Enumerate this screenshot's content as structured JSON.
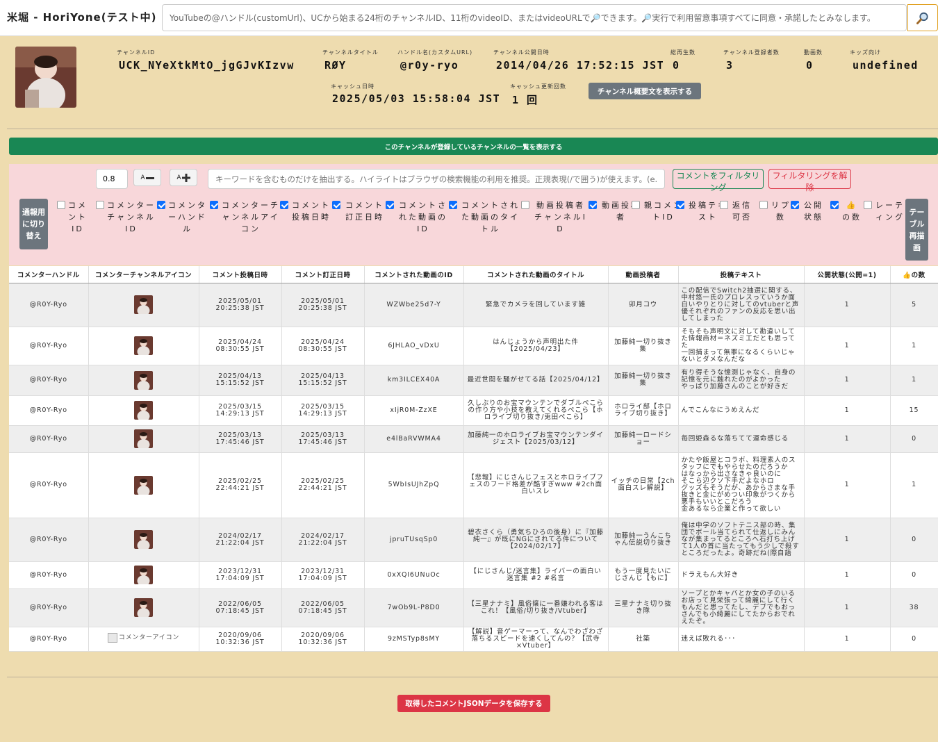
{
  "header": {
    "brand": "米堀 - HoriYone(テスト中)",
    "search_placeholder": "YouTubeの@ハンドル(customUrl)、UCから始まる24桁のチャンネルID、11桁のvideoID、またはvideoURLで🔎できます。🔎実行で利用留意事項すべてに同意・承諾したとみなします。",
    "search_icon": "magnifier-icon"
  },
  "channel": {
    "id_label": "チャンネルID",
    "id": "UCK_NYeXtkMtO_jgGJvKIzvw",
    "title_label": "チャンネルタイトル",
    "title": "RØY",
    "handle_label": "ハンドル名(カスタムURL)",
    "handle": "@r0y-ryo",
    "published_label": "チャンネル公開日時",
    "published": "2014/04/26 17:52:15 JST",
    "views_label": "総再生数",
    "views": "0",
    "subs_label": "チャンネル登録者数",
    "subs": "3",
    "videos_label": "動画数",
    "videos": "0",
    "kids_label": "キッズ向け",
    "kids": "undefined",
    "cache_label": "キャッシュ日時",
    "cache": "2025/05/03 15:58:04 JST",
    "cache_count_label": "キャッシュ更新回数",
    "cache_count": "1 回",
    "summary_button": "チャンネル概要文を表示する"
  },
  "subscriptions_button": "このチャンネルが登録しているチャンネルの一覧を表示する",
  "filter": {
    "font_size": "0.8",
    "font_small_label": "A",
    "font_large_label": "A",
    "keyword_placeholder": "キーワードを含むものだけを抽出する。ハイライトはブラウザの検索機能の利用を推奨。正規表現(/で囲う)が使えます。(e.g. /(BC|AB)/)",
    "filter_button": "コメントをフィルタリング",
    "clear_button": "フィルタリングを解除",
    "report_toggle": "通報用に切り替え",
    "redraw": "テーブル再描画",
    "columns": [
      {
        "label": "コメントID",
        "checked": false
      },
      {
        "label": "コメンターチャンネルID",
        "checked": false
      },
      {
        "label": "コメンターハンドル",
        "checked": true
      },
      {
        "label": "コメンターチャンネルアイコン",
        "checked": true
      },
      {
        "label": "コメント投稿日時",
        "checked": true
      },
      {
        "label": "コメント訂正日時",
        "checked": true
      },
      {
        "label": "コメントされた動画のID",
        "checked": true
      },
      {
        "label": "コメントされた動画のタイトル",
        "checked": true
      },
      {
        "label": "動画投稿者チャンネルID",
        "checked": false
      },
      {
        "label": "動画投稿者",
        "checked": true
      },
      {
        "label": "親コメントID",
        "checked": false
      },
      {
        "label": "投稿テキスト",
        "checked": true
      },
      {
        "label": "返信可否",
        "checked": false
      },
      {
        "label": "リプ数",
        "checked": false
      },
      {
        "label": "公開状態",
        "checked": true
      },
      {
        "label": "👍の数",
        "checked": true
      },
      {
        "label": "レーティング",
        "checked": false
      }
    ]
  },
  "table": {
    "headers": [
      "コメンターハンドル",
      "コメンターチャンネルアイコン",
      "コメント投稿日時",
      "コメント訂正日時",
      "コメントされた動画のID",
      "コメントされた動画のタイトル",
      "動画投稿者",
      "投稿テキスト",
      "公開状態(公開=1)",
      "👍の数"
    ],
    "broken_icon_alt": "コメンターアイコン",
    "rows": [
      {
        "handle": "@R0Y-Ryo",
        "icon": true,
        "posted": "2025/05/01\n20:25:38 JST",
        "edited": "2025/05/01\n20:25:38 JST",
        "video_id": "WZWbe25d7-Y",
        "video_title": "緊急でカメラを回しています雑",
        "uploader": "卯月コウ",
        "text": "この配信でSwitch2抽選に関する、中村悠一氏のプロレスっていうか面白いやりとりに対してのvtuberと声優それぞれのファンの反応を思い出してしまった",
        "public": "1",
        "likes": "5"
      },
      {
        "handle": "@R0Y-Ryo",
        "icon": true,
        "posted": "2025/04/24\n08:30:55 JST",
        "edited": "2025/04/24\n08:30:55 JST",
        "video_id": "6JHLAO_vDxU",
        "video_title": "はんじょうから声明出た件【2025/04/23】",
        "uploader": "加藤純一切り抜き集",
        "text": "そもそも声明文に対して勘違いしてた情報商材＝ネズミ工だとも思ってた\n一回捕まって無罪になるくらいじゃないとダメなんだな",
        "public": "1",
        "likes": "1"
      },
      {
        "handle": "@R0Y-Ryo",
        "icon": true,
        "posted": "2025/04/13\n15:15:52 JST",
        "edited": "2025/04/13\n15:15:52 JST",
        "video_id": "km3ILCEX40A",
        "video_title": "最近世間を騒がせてる話【2025/04/12】",
        "uploader": "加藤純一切り抜き集",
        "text": "有り得そうな憶測じゃなく、自身の記憶を元に触れたのがよかった\nやっぱり加藤さんのことが好きだ",
        "public": "1",
        "likes": "1"
      },
      {
        "handle": "@R0Y-Ryo",
        "icon": true,
        "posted": "2025/03/15\n14:29:13 JST",
        "edited": "2025/03/15\n14:29:13 JST",
        "video_id": "xIjR0M-ZzXE",
        "video_title": "久しぶりのお宝マウンテンでダブルぺこらの作り方や小技を教えてくれるぺこら【ホロライブ切り抜き/兎田ぺこら】",
        "uploader": "ホロライ部【ホロライブ切り抜き】",
        "text": "んでこんなにうめえんだ",
        "public": "1",
        "likes": "15"
      },
      {
        "handle": "@R0Y-Ryo",
        "icon": true,
        "posted": "2025/03/13\n17:45:46 JST",
        "edited": "2025/03/13\n17:45:46 JST",
        "video_id": "e4lBaRVWMA4",
        "video_title": "加藤純一のホロライブお宝マウンテンダイジェスト【2025/03/12】",
        "uploader": "加藤純一ロードショー",
        "text": "毎回姫森るな落ちてて運命感じる",
        "public": "1",
        "likes": "0"
      },
      {
        "handle": "@R0Y-Ryo",
        "icon": true,
        "posted": "2025/02/25\n22:44:21 JST",
        "edited": "2025/02/25\n22:44:21 JST",
        "video_id": "5WbIsUJhZpQ",
        "video_title": "【悲報】にじさんじフェスとホロライブフェスのフード格差が酷すぎwww #2ch面白いスレ",
        "uploader": "イッチの日常【2ch面白スレ解説】",
        "text": "かたや飯屋とコラボ、料理素人のスタッフにでもやらせたのだろうか\nはなっから出さなきゃ良いのに\nそこら辺クソ下手だよなホロ\nグッズもそうだが、あからさまな手抜きと金にがめつい印象がつくから悪手もいいとこだろう\n金あるなら企業と作って欲しい",
        "public": "1",
        "likes": "1"
      },
      {
        "handle": "@R0Y-Ryo",
        "icon": true,
        "posted": "2024/02/17\n21:22:04 JST",
        "edited": "2024/02/17\n21:22:04 JST",
        "video_id": "jpruTUsqSp0",
        "video_title": "碧衣さくら（勇気ちひろの後身）に『加藤純一』が既にNGにされてる件について【2024/02/17】",
        "uploader": "加藤純一うんこちゃん伝説切り抜き",
        "text": "俺は中学のソフトテニス部の時、集団でボール当てられて仕返しにみんなが集まってるところへ石打ち上げて1人の首に当たってもう少しで殺すところだったよ。奇跡だね(際自語",
        "public": "1",
        "likes": "0"
      },
      {
        "handle": "@R0Y-Ryo",
        "icon": true,
        "posted": "2023/12/31\n17:04:09 JST",
        "edited": "2023/12/31\n17:04:09 JST",
        "video_id": "0xXQI6UNuOc",
        "video_title": "【にじさんじ/迷言集】ライバーの面白い迷言集 #2 #名言",
        "uploader": "もう一度見たいにじさんじ【もに】",
        "text": "ドラえもん大好き",
        "public": "1",
        "likes": "0"
      },
      {
        "handle": "@R0Y-Ryo",
        "icon": true,
        "posted": "2022/06/05\n07:18:45 JST",
        "edited": "2022/06/05\n07:18:45 JST",
        "video_id": "7wOb9L-P8D0",
        "video_title": "【三星ナナミ】風俗嬢に一番嫌われる客はこれ！【風俗/切り抜き/Vtuber】",
        "uploader": "三星ナナミ切り抜き隊",
        "text": "ソープとかキャバとか女の子のいるお店って見栄張って綺麗にして行くもんだと思ってたし、デブでもおっさんでも小綺麗にしてたからおでれえたぞ。",
        "public": "1",
        "likes": "38"
      },
      {
        "handle": "@R0Y-Ryo",
        "icon": false,
        "posted": "2020/09/06\n10:32:36 JST",
        "edited": "2020/09/06\n10:32:36 JST",
        "video_id": "9zMSTyp8sMY",
        "video_title": "【解説】音ゲーマーって、なんでわざわざ落ちるスピードを速くしてんの？【武寺×Vtuber】",
        "uploader": "社築",
        "text": "迷えば敗れる･･･",
        "public": "1",
        "likes": "0"
      }
    ]
  },
  "save_button": "取得したコメントJSONデータを保存する"
}
